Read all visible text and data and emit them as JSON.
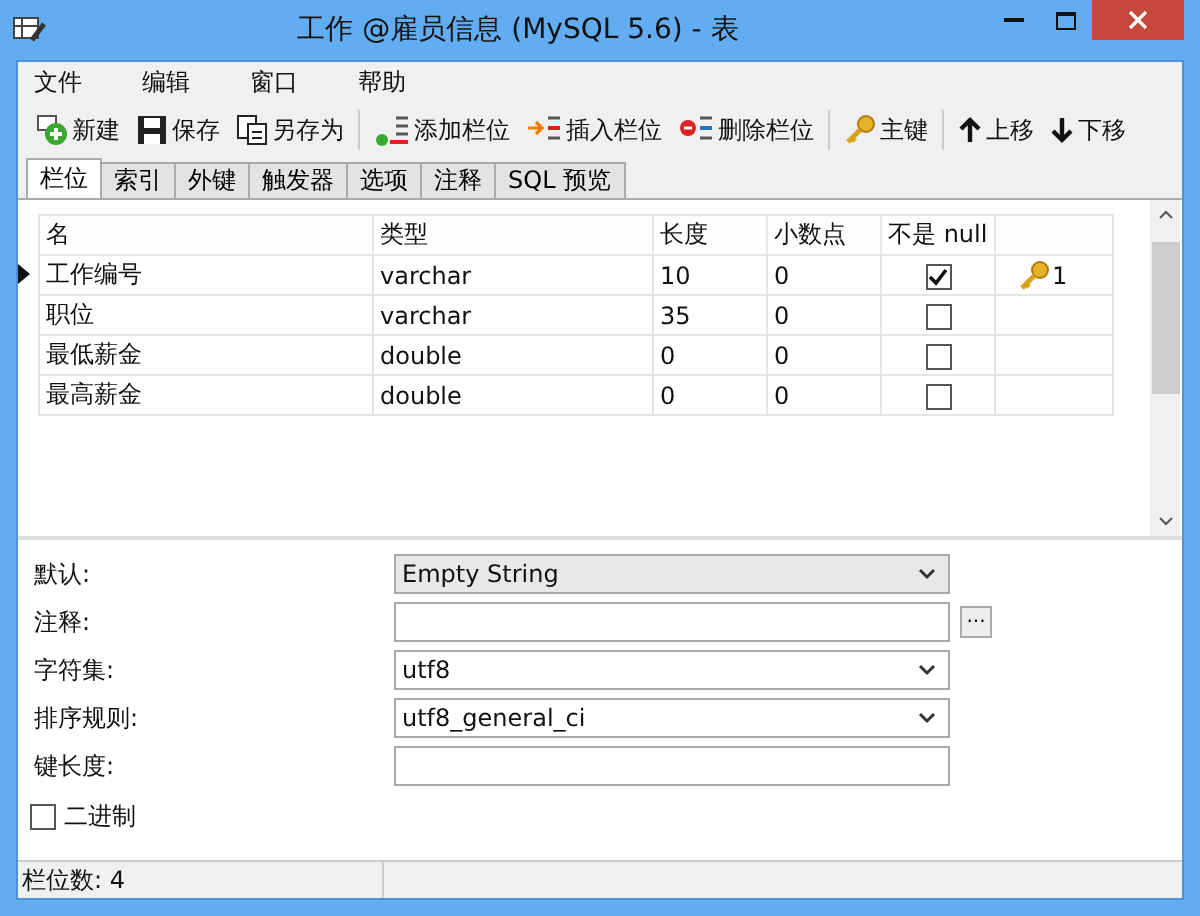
{
  "window": {
    "title": "工作 @雇员信息 (MySQL 5.6) - 表"
  },
  "menu": [
    "文件",
    "编辑",
    "窗口",
    "帮助"
  ],
  "toolbar": [
    [
      {
        "label": "新建"
      },
      {
        "label": "保存"
      },
      {
        "label": "另存为"
      }
    ],
    [
      {
        "label": "添加栏位"
      },
      {
        "label": "插入栏位"
      },
      {
        "label": "删除栏位"
      }
    ],
    [
      {
        "label": "主键"
      }
    ],
    [
      {
        "label": "上移"
      },
      {
        "label": "下移"
      }
    ]
  ],
  "tabs": [
    {
      "label": "栏位",
      "selected": true
    },
    {
      "label": "索引",
      "selected": false
    },
    {
      "label": "外键",
      "selected": false
    },
    {
      "label": "触发器",
      "selected": false
    },
    {
      "label": "选项",
      "selected": false
    },
    {
      "label": "注释",
      "selected": false
    },
    {
      "label": "SQL 预览",
      "selected": false
    }
  ],
  "table": {
    "columns": [
      "名",
      "类型",
      "长度",
      "小数点",
      "不是 null"
    ],
    "rows": [
      {
        "name": "工作编号",
        "type": "varchar",
        "length": "10",
        "decimals": "0",
        "not_null": true,
        "key": "1",
        "selected": true
      },
      {
        "name": "职位",
        "type": "varchar",
        "length": "35",
        "decimals": "0",
        "not_null": false,
        "selected": false
      },
      {
        "name": "最低薪金",
        "type": "double",
        "length": "0",
        "decimals": "0",
        "not_null": false,
        "selected": false
      },
      {
        "name": "最高薪金",
        "type": "double",
        "length": "0",
        "decimals": "0",
        "not_null": false,
        "selected": false
      }
    ]
  },
  "properties": [
    {
      "label": "默认:",
      "kind": "dropdown",
      "value": "Empty String"
    },
    {
      "label": "注释:",
      "kind": "text_button",
      "button": "..."
    },
    {
      "label": "字符集:",
      "kind": "select",
      "value": "utf8"
    },
    {
      "label": "排序规则:",
      "kind": "select",
      "value": "utf8_general_ci"
    },
    {
      "label": "键长度:",
      "kind": "text"
    }
  ],
  "binary": {
    "label": "二进制",
    "checked": false
  },
  "status_bar": {
    "text": "栏位数: 4"
  }
}
